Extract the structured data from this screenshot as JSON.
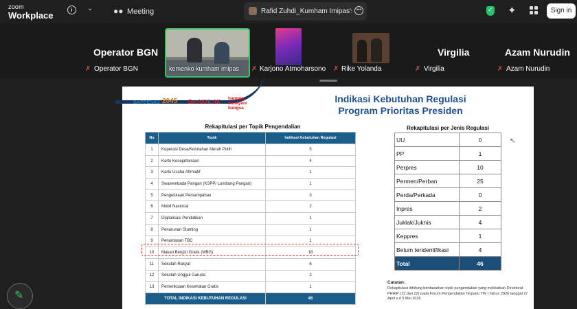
{
  "topbar": {
    "logo_small": "zoom",
    "logo_main": "Workplace",
    "meeting_label": "Meeting",
    "share_label": "Rafid Zuhdi_Kumham Imipas's sc",
    "signin_label": "Sign in",
    "accent_color": "#27c46b"
  },
  "gallery": {
    "tiles": [
      {
        "name": "Operator BGN",
        "label": "Operator BGN"
      },
      {
        "label": "kemenko kumham imipas"
      },
      {
        "label": "Karjono Atmoharsono"
      },
      {
        "label": "Rike Yolanda"
      },
      {
        "name": "Virgilia",
        "label": "Virgilia"
      },
      {
        "name": "Azam Nurudin",
        "label": "Azam Nurudin"
      }
    ]
  },
  "slide": {
    "logos": [
      "BAPPENAS",
      "2045",
      "BerAKHLAK",
      "bangga melayani bangsa"
    ],
    "title_line1": "Indikasi Kebutuhan Regulasi",
    "title_line2": "Program Prioritas Presiden",
    "topic_table": {
      "caption": "Rekapitulasi per Topik Pengendalian",
      "headers": [
        "No",
        "Topik",
        "Indikasi Kebutuhan Regulasi"
      ],
      "rows": [
        {
          "no": "1",
          "topic": "Koperasi Desa/Kelurahan Merah Putih",
          "value": "5"
        },
        {
          "no": "2",
          "topic": "Kartu Kesejahteraan",
          "value": "4"
        },
        {
          "no": "3",
          "topic": "Kartu Usaha Afirmatif",
          "value": "1"
        },
        {
          "no": "4",
          "topic": "Swasembada Pangan (KSPP/ Lumbung Pangan)",
          "value": "1"
        },
        {
          "no": "5",
          "topic": "Pengelolaan Persampahan",
          "value": "3"
        },
        {
          "no": "6",
          "topic": "Mobil Nasional",
          "value": "2"
        },
        {
          "no": "7",
          "topic": "Digitalisasi Pendidikan",
          "value": "1"
        },
        {
          "no": "8",
          "topic": "Penurunan Stunting",
          "value": "1"
        },
        {
          "no": "9",
          "topic": "Penuntasan TBC",
          "value": "1"
        },
        {
          "no": "10",
          "topic": "Makan Bergizi Gratis (MBG)",
          "value": "18"
        },
        {
          "no": "11",
          "topic": "Sekolah Rakyat",
          "value": "6"
        },
        {
          "no": "12",
          "topic": "Sekolah Unggul Garuda",
          "value": "2"
        },
        {
          "no": "13",
          "topic": "Pemeriksaan Kesehatan Gratis",
          "value": "1"
        }
      ],
      "total_label": "TOTAL INDIKASI KEBUTUHAN REGULASI",
      "total_value": "46"
    },
    "type_table": {
      "caption": "Rekapitulasi per Jenis Regulasi",
      "rows": [
        {
          "type": "UU",
          "value": "0"
        },
        {
          "type": "PP",
          "value": "1"
        },
        {
          "type": "Perpres",
          "value": "10"
        },
        {
          "type": "Permen/Perban",
          "value": "25"
        },
        {
          "type": "Perda/Perkada",
          "value": "0"
        },
        {
          "type": "Inpres",
          "value": "2"
        },
        {
          "type": "Juklak/Juknis",
          "value": "4"
        },
        {
          "type": "Keppres",
          "value": "1"
        },
        {
          "type": "Belum teridentifikasi",
          "value": "4"
        }
      ],
      "total_label": "Total",
      "total_value": "46"
    },
    "notes_title": "Catatan:",
    "notes_text": "Rekapitulasi dihitung berdasarkan topik pengendalian yang melibatkan Direktorat PHHIP (13 dari 22) pada Forum Pengendalian Terpadu TW I Tahun 2026 tanggal 27 April s.d 5 Mei 2026"
  }
}
